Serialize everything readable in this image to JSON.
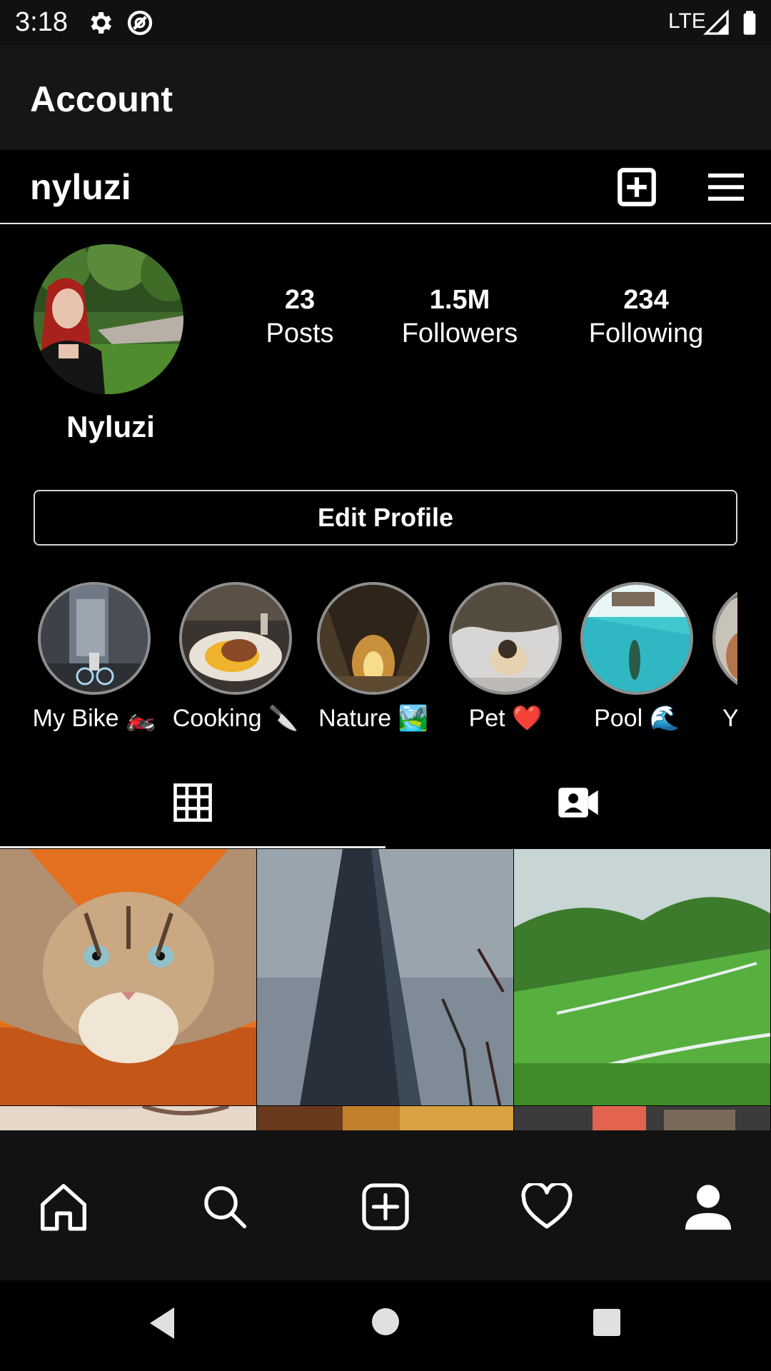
{
  "status_bar": {
    "time": "3:18",
    "network": "LTE",
    "icons": [
      "settings-icon",
      "data-saver-icon",
      "signal-icon",
      "battery-icon"
    ]
  },
  "app_bar": {
    "title": "Account"
  },
  "header": {
    "username": "nyluzi",
    "icons": [
      "add-post-icon",
      "menu-icon"
    ]
  },
  "profile": {
    "name": "Nyluzi",
    "stats": [
      {
        "value": "23",
        "label": "Posts"
      },
      {
        "value": "1.5M",
        "label": "Followers"
      },
      {
        "value": "234",
        "label": "Following"
      }
    ],
    "edit_label": "Edit Profile"
  },
  "highlights": [
    {
      "label": "My Bike 🏍️"
    },
    {
      "label": "Cooking 🔪"
    },
    {
      "label": "Nature 🏞️"
    },
    {
      "label": "Pet ❤️"
    },
    {
      "label": "Pool 🌊"
    },
    {
      "label": "Y"
    }
  ],
  "tabs": [
    {
      "icon": "grid-icon",
      "active": true
    },
    {
      "icon": "tagged-video-icon",
      "active": false
    }
  ],
  "bottom_nav": {
    "items": [
      "home-icon",
      "search-icon",
      "add-icon",
      "heart-icon",
      "profile-icon"
    ]
  },
  "system_nav": [
    "back-icon",
    "home-circle-icon",
    "recents-icon"
  ],
  "colors": {
    "background": "#000000",
    "app_bar": "#161616",
    "bottom_nav": "#121212",
    "text": "#ffffff",
    "ring": "#8e8e8e"
  }
}
